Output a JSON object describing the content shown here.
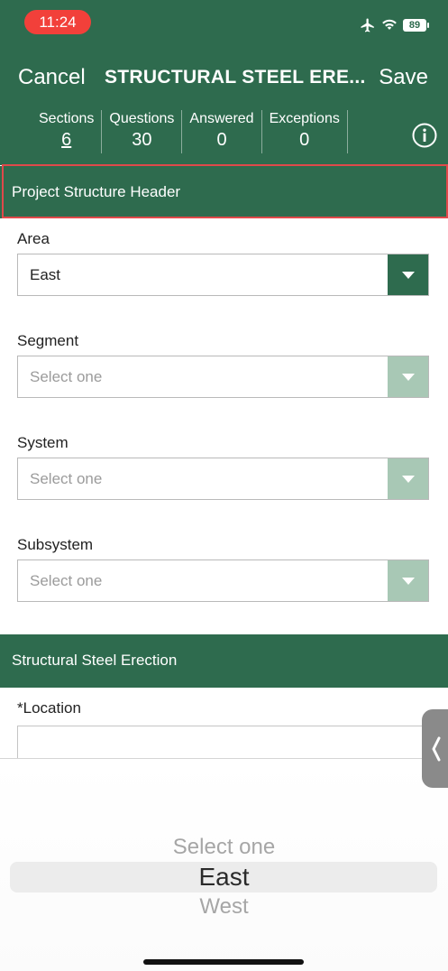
{
  "status_bar": {
    "time": "11:24",
    "battery": "89",
    "icons": [
      "airplane-icon",
      "wifi-icon",
      "battery-icon"
    ]
  },
  "nav": {
    "cancel": "Cancel",
    "title": "STRUCTURAL STEEL ERECTION",
    "title_display": "STRUCTURAL STEEL ERE...",
    "save": "Save"
  },
  "stats": [
    {
      "label": "Sections",
      "value": "6"
    },
    {
      "label": "Questions",
      "value": "30"
    },
    {
      "label": "Answered",
      "value": "0"
    },
    {
      "label": "Exceptions",
      "value": "0"
    }
  ],
  "sections": {
    "project_header": "Project Structure Header",
    "steel_erection": "Structural Steel Erection"
  },
  "fields": {
    "area": {
      "label": "Area",
      "value": "East"
    },
    "segment": {
      "label": "Segment",
      "placeholder": "Select one"
    },
    "system": {
      "label": "System",
      "placeholder": "Select one"
    },
    "subsystem": {
      "label": "Subsystem",
      "placeholder": "Select one"
    },
    "location": {
      "required_mark": "*",
      "label": "Location",
      "value": ""
    }
  },
  "picker": {
    "options": [
      "Select one",
      "East",
      "West"
    ],
    "selected": "East"
  },
  "colors": {
    "brand_green": "#2e6b4e",
    "caret_disabled": "#a8c8b5",
    "highlight": "#e0494a",
    "status_red": "#f2403a"
  }
}
